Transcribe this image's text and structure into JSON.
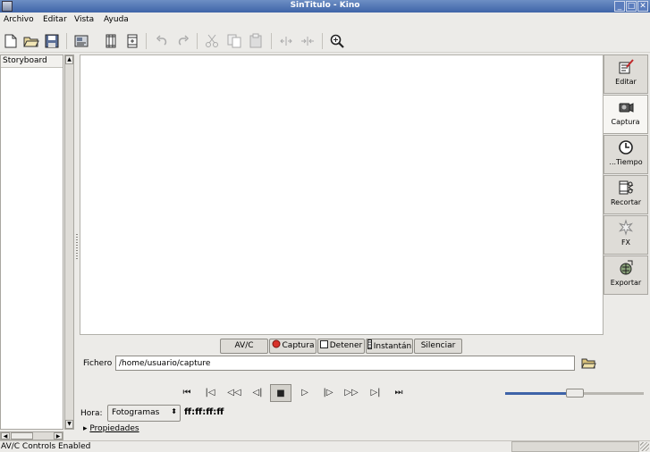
{
  "window": {
    "title": "SinTitulo - Kino"
  },
  "menubar": {
    "items": [
      "Archivo",
      "Editar",
      "Vista",
      "Ayuda"
    ]
  },
  "storyboard": {
    "header": "Storyboard"
  },
  "side_tabs": [
    {
      "label": "Editar",
      "icon": "edit-icon"
    },
    {
      "label": "Captura",
      "icon": "camera-icon"
    },
    {
      "label": "...Tiempo",
      "icon": "clock-icon"
    },
    {
      "label": "Recortar",
      "icon": "trim-icon"
    },
    {
      "label": "FX",
      "icon": "fx-icon"
    },
    {
      "label": "Exportar",
      "icon": "export-icon"
    }
  ],
  "capture_buttons": [
    {
      "label": "AV/C"
    },
    {
      "label": "Captura"
    },
    {
      "label": "Detener"
    },
    {
      "label": "Instantán"
    },
    {
      "label": "Silenciar"
    }
  ],
  "fichero": {
    "label": "Fichero",
    "value": "/home/usuario/capture"
  },
  "hora": {
    "label": "Hora:",
    "select_value": "Fotogramas",
    "timecode": "ff:ff:ff:ff"
  },
  "propiedades": {
    "label": "Propiedades"
  },
  "status": {
    "text": "AV/C Controls Enabled"
  },
  "slider": {
    "position": 0.5
  },
  "colors": {
    "title_bar": "#3f64a8",
    "capture_red": "#d8322a",
    "slider_fill": "#3e63a8"
  }
}
